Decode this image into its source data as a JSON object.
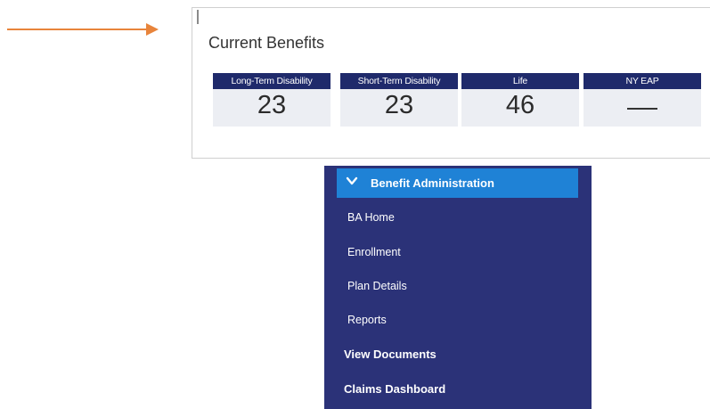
{
  "panel": {
    "title": "Current Benefits",
    "cards": [
      {
        "label": "Long-Term Disability",
        "value": "23"
      },
      {
        "label": "Short-Term Disability",
        "value": "23"
      },
      {
        "label": "Life",
        "value": "46"
      },
      {
        "label": "NY EAP",
        "value": ""
      }
    ]
  },
  "nav": {
    "section": "Benefit Administration",
    "sub_items": [
      "BA Home",
      "Enrollment",
      "Plan Details",
      "Reports"
    ],
    "top_items": [
      "View Documents",
      "Claims Dashboard"
    ]
  },
  "colors": {
    "annotation_arrow": "#e8843b",
    "card_header": "#1f2a6b",
    "card_body": "#eceef3",
    "nav_background": "#2b3278",
    "nav_active": "#1f82d6"
  },
  "icons": {
    "annotation": "arrow-right-icon",
    "section_toggle": "chevron-down-icon"
  }
}
